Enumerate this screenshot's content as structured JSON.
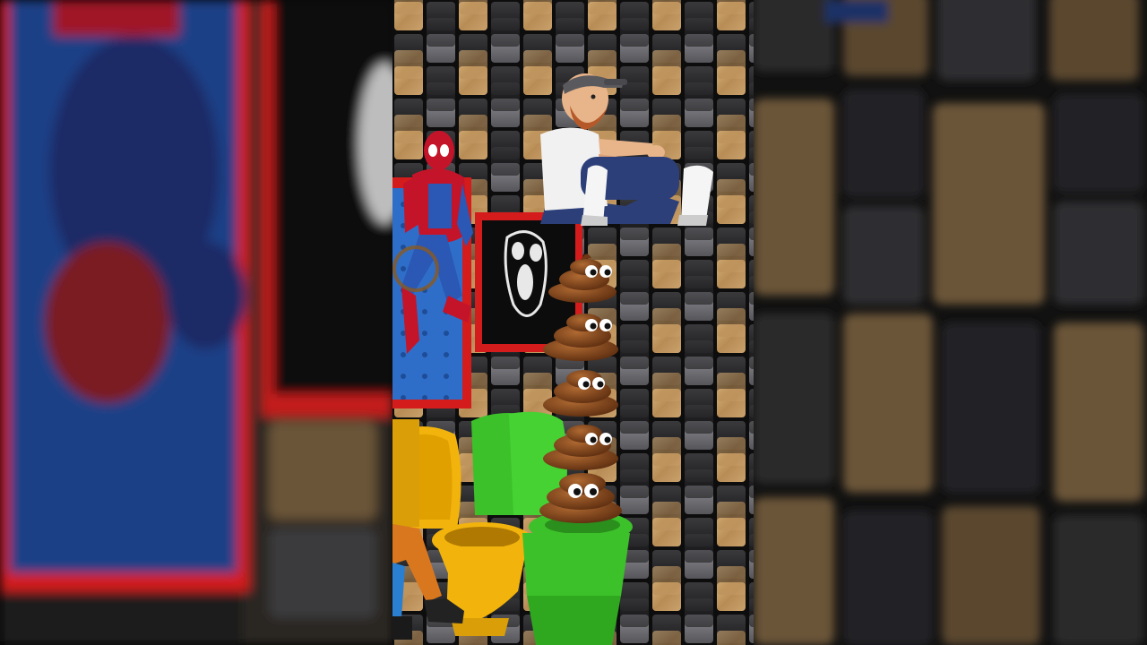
{
  "scene": {
    "description_labels": [],
    "colors": {
      "wood": "#c9a46f",
      "dark_tile": "#2a2a2c",
      "frame_red": "#d41c1c",
      "toilet_yellow": "#f2b40c",
      "toilet_green": "#3cc12a",
      "poop_brown": "#8a4a1e",
      "spider_red": "#c4142a",
      "spider_blue": "#2b57b5"
    },
    "icons": [
      "spiderman-figure",
      "bearded-man-figure",
      "ghost-face-painting",
      "poop-stack",
      "yellow-toilet",
      "green-toilet"
    ]
  }
}
